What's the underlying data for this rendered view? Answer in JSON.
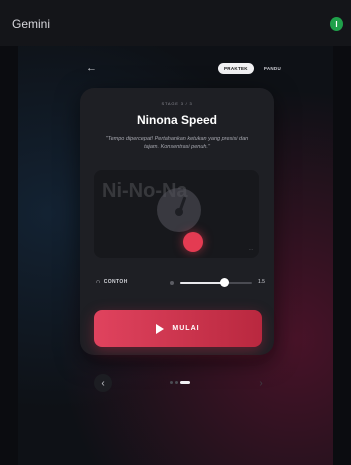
{
  "app": {
    "title": "Gemini",
    "avatar_initial": "I"
  },
  "nav": {
    "back_glyph": "←",
    "modes": [
      {
        "label": "PRAKTEK",
        "active": true
      },
      {
        "label": "PANDU",
        "active": false
      }
    ]
  },
  "card": {
    "stage_label": "STAGE 3 / 3",
    "title": "Ninona Speed",
    "description": "\"Tempo dipercepat! Pertahankan ketukan yang presisi dan tajam. Konsentrasi penuh.\"",
    "watermark": "Ni-No-Na",
    "corner_mark": "..."
  },
  "controls": {
    "example_label": "CONTOH",
    "example_icon": "headphones-icon",
    "speed_value": "1.5",
    "speed_fraction": 0.62
  },
  "start": {
    "label": "MULAI",
    "icon": "play-icon"
  },
  "pager": {
    "prev_glyph": "‹",
    "next_glyph": "›",
    "page_count": 3,
    "current": 3
  },
  "colors": {
    "accent": "#e0435e",
    "avatar": "#1fa04a",
    "card": "#1e1f24"
  }
}
